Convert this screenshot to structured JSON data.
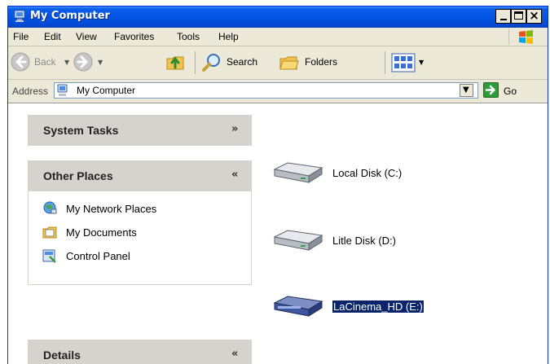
{
  "window": {
    "title": "My Computer"
  },
  "menubar": {
    "items": [
      "File",
      "Edit",
      "View",
      "Favorites",
      "Tools",
      "Help"
    ]
  },
  "toolbar": {
    "back_label": "Back",
    "search_label": "Search",
    "folders_label": "Folders"
  },
  "address": {
    "label": "Address",
    "value": "My Computer",
    "go_label": "Go"
  },
  "sidebar": {
    "system_tasks": {
      "title": "System Tasks",
      "state": "collapsed"
    },
    "other_places": {
      "title": "Other Places",
      "state": "expanded",
      "items": [
        {
          "label": "My Network Places",
          "icon": "network-places-icon"
        },
        {
          "label": "My Documents",
          "icon": "documents-folder-icon"
        },
        {
          "label": "Control Panel",
          "icon": "control-panel-icon"
        }
      ]
    },
    "details": {
      "title": "Details",
      "state": "expanded"
    }
  },
  "drives": [
    {
      "label": "Local Disk (C:)",
      "icon": "hard-disk-icon",
      "selected": false
    },
    {
      "label": "Litle Disk (D:)",
      "icon": "hard-disk-icon",
      "selected": false
    },
    {
      "label": "LaCinema_HD (E:)",
      "icon": "media-drive-icon",
      "selected": true
    }
  ],
  "colors": {
    "titlebar": "#0454e3",
    "chrome": "#ece9d8",
    "pane_header": "#d6d3ce",
    "selection": "#0a246a"
  }
}
